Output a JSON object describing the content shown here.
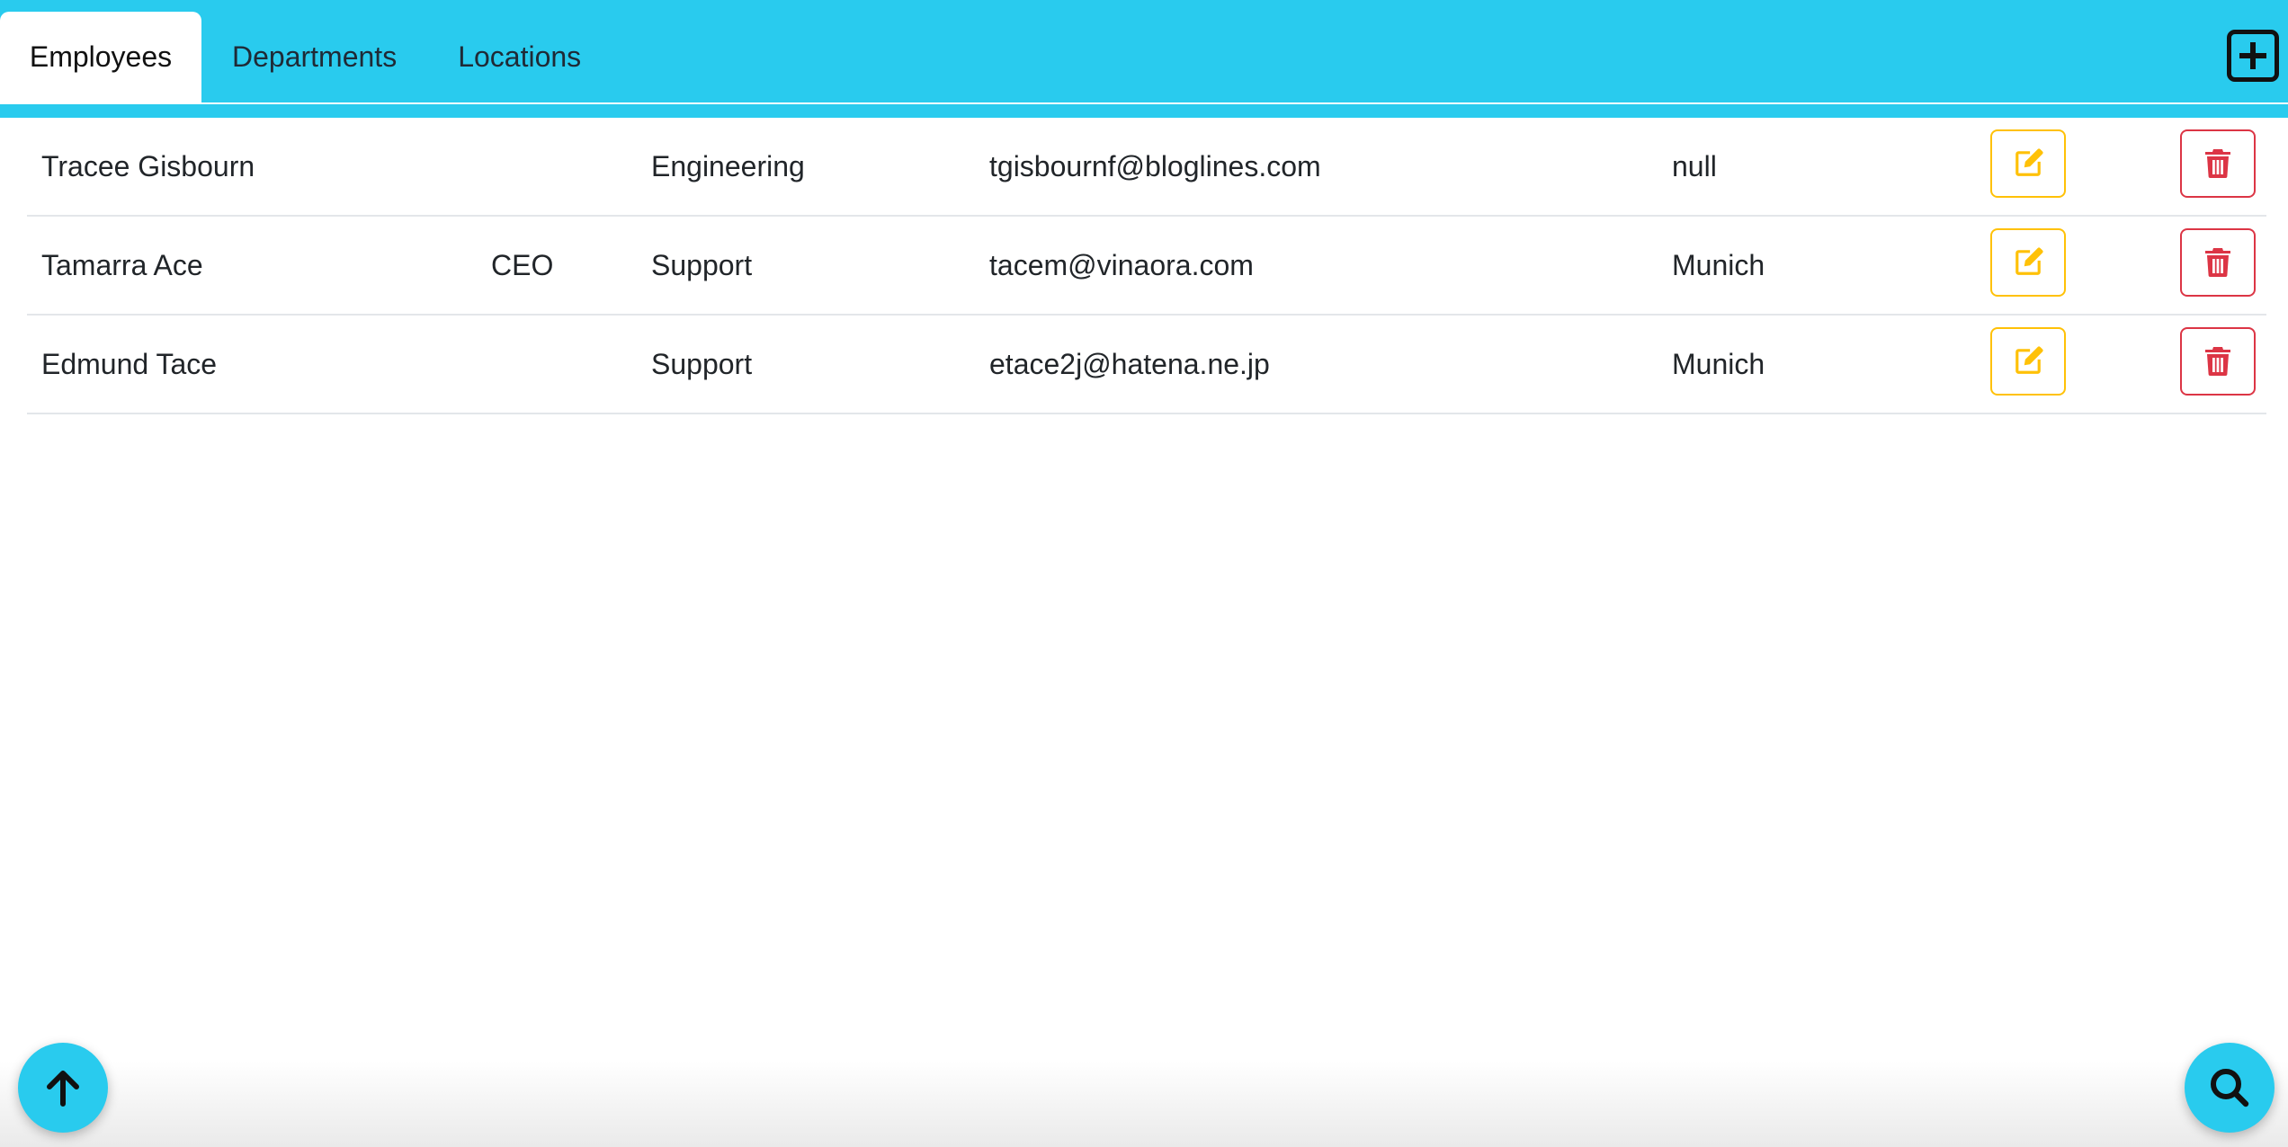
{
  "tabs": [
    {
      "label": "Employees",
      "active": true
    },
    {
      "label": "Departments",
      "active": false
    },
    {
      "label": "Locations",
      "active": false
    }
  ],
  "header": {
    "add_icon": "plus-square-icon",
    "accent_color": "#29cbee"
  },
  "employees": [
    {
      "name": "Tracee Gisbourn",
      "job_title": "",
      "department": "Engineering",
      "email": "tgisbournf@bloglines.com",
      "location": "null"
    },
    {
      "name": "Tamarra Ace",
      "job_title": "CEO",
      "department": "Support",
      "email": "tacem@vinaora.com",
      "location": "Munich"
    },
    {
      "name": "Edmund Tace",
      "job_title": "",
      "department": "Support",
      "email": "etace2j@hatena.ne.jp",
      "location": "Munich"
    }
  ],
  "row_actions": {
    "edit_icon": "pencil-square-icon",
    "edit_color": "#ffc107",
    "delete_icon": "trash-icon",
    "delete_color": "#dc3545"
  },
  "fabs": {
    "scroll_top_icon": "arrow-up-icon",
    "search_icon": "search-icon"
  }
}
